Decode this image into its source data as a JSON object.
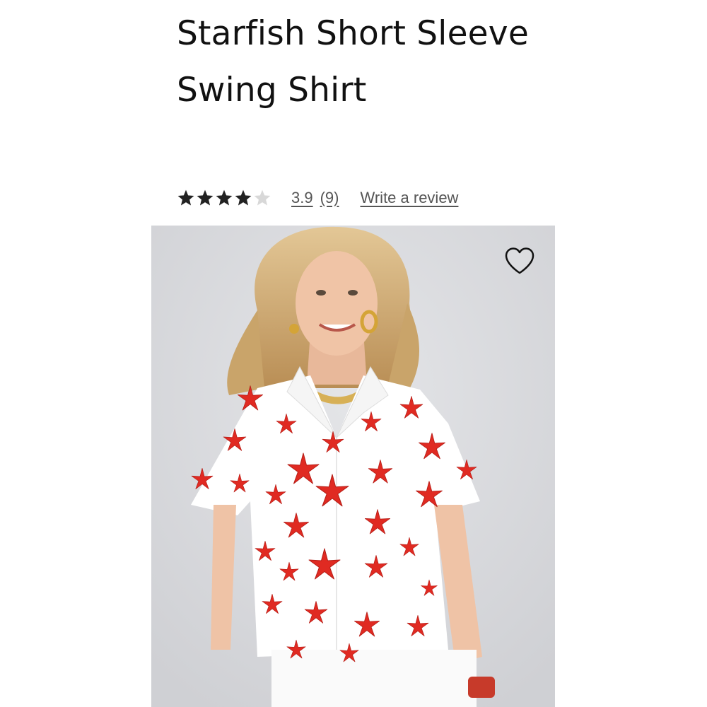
{
  "product": {
    "title": "Starfish Short Sleeve Swing Shirt",
    "rating": {
      "value": 3.9,
      "value_text": "3.9",
      "count_text": "(9)",
      "stars_filled": 4,
      "stars_total": 5,
      "star_color": "#222222",
      "star_empty_color": "#d8d8d8"
    },
    "write_review_label": "Write a review",
    "image": {
      "background_color": "#dcdde0",
      "shirt_color": "#ffffff",
      "starfish_color": "#e02a22",
      "icon": "heart-outline-icon"
    }
  }
}
